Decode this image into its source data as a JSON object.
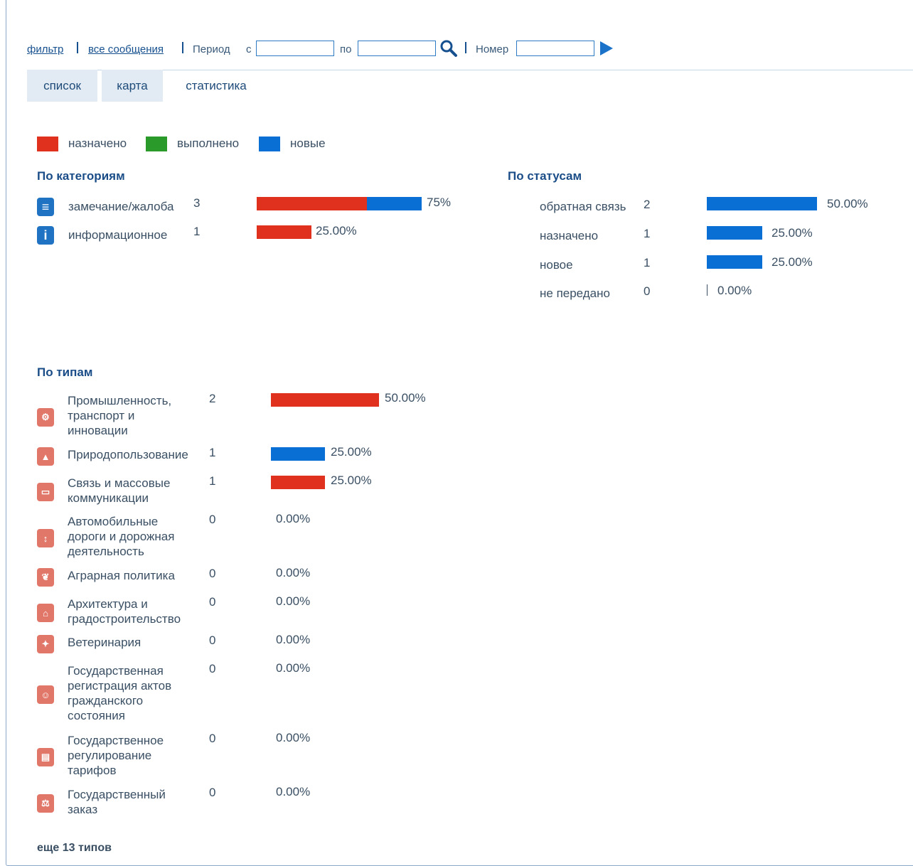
{
  "filter": {
    "filter_link": "фильтр",
    "all_link": "все сообщения",
    "period_label": "Период",
    "from_label": "с",
    "to_label": "по",
    "number_label": "Номер",
    "from_value": "",
    "to_value": "",
    "number_value": ""
  },
  "tabs": [
    "список",
    "карта",
    "статистика"
  ],
  "legend": [
    "назначено",
    "выполнено",
    "новые"
  ],
  "colors": {
    "assigned": "#e0301e",
    "done": "#2a9a2a",
    "new": "#0a6fd4"
  },
  "categories": {
    "title": "По категориям",
    "items": [
      {
        "icon": "complaint-icon",
        "label": "замечание/жалоба",
        "count": "3",
        "pct": "75%",
        "assigned": 0.5,
        "new": 0.25
      },
      {
        "icon": "info-icon",
        "label": "информационное",
        "count": "1",
        "pct": "25.00%",
        "assigned": 0.25,
        "new": 0
      }
    ]
  },
  "statuses": {
    "title": "По статусам",
    "items": [
      {
        "label": "обратная связь",
        "count": "2",
        "pct": "50.00%",
        "value": 0.5
      },
      {
        "label": "назначено",
        "count": "1",
        "pct": "25.00%",
        "value": 0.25
      },
      {
        "label": "новое",
        "count": "1",
        "pct": "25.00%",
        "value": 0.25
      },
      {
        "label": "не передано",
        "count": "0",
        "pct": "0.00%",
        "value": 0
      }
    ]
  },
  "types": {
    "title": "По типам",
    "items": [
      {
        "icon": "industry-icon",
        "lines": [
          "Промышленность,",
          "транспорт и",
          "инновации"
        ],
        "count": "2",
        "pct": "50.00%",
        "value": 0.5,
        "color": "assigned"
      },
      {
        "icon": "nature-icon",
        "lines": [
          "Природопользование"
        ],
        "count": "1",
        "pct": "25.00%",
        "value": 0.25,
        "color": "new"
      },
      {
        "icon": "tv-icon",
        "lines": [
          "Связь и массовые",
          "коммуникации"
        ],
        "count": "1",
        "pct": "25.00%",
        "value": 0.25,
        "color": "assigned"
      },
      {
        "icon": "road-icon",
        "lines": [
          "Автомобильные",
          "дороги и дорожная",
          "деятельность"
        ],
        "count": "0",
        "pct": "0.00%",
        "value": 0,
        "color": "assigned"
      },
      {
        "icon": "agriculture-icon",
        "lines": [
          "Аграрная политика"
        ],
        "count": "0",
        "pct": "0.00%",
        "value": 0,
        "color": "assigned"
      },
      {
        "icon": "architecture-icon",
        "lines": [
          "Архитектура и",
          "градостроительство"
        ],
        "count": "0",
        "pct": "0.00%",
        "value": 0,
        "color": "assigned"
      },
      {
        "icon": "veterinary-icon",
        "lines": [
          "Ветеринария"
        ],
        "count": "0",
        "pct": "0.00%",
        "value": 0,
        "color": "assigned"
      },
      {
        "icon": "civil-registry-icon",
        "lines": [
          "Государственная",
          "регистрация актов",
          "гражданского",
          "состояния"
        ],
        "count": "0",
        "pct": "0.00%",
        "value": 0,
        "color": "assigned"
      },
      {
        "icon": "tariff-icon",
        "lines": [
          "Государственное",
          "регулирование",
          "тарифов"
        ],
        "count": "0",
        "pct": "0.00%",
        "value": 0,
        "color": "assigned"
      },
      {
        "icon": "procurement-icon",
        "lines": [
          "Государственный",
          "заказ"
        ],
        "count": "0",
        "pct": "0.00%",
        "value": 0,
        "color": "assigned"
      }
    ]
  },
  "more_types": "еще 13 типов"
}
